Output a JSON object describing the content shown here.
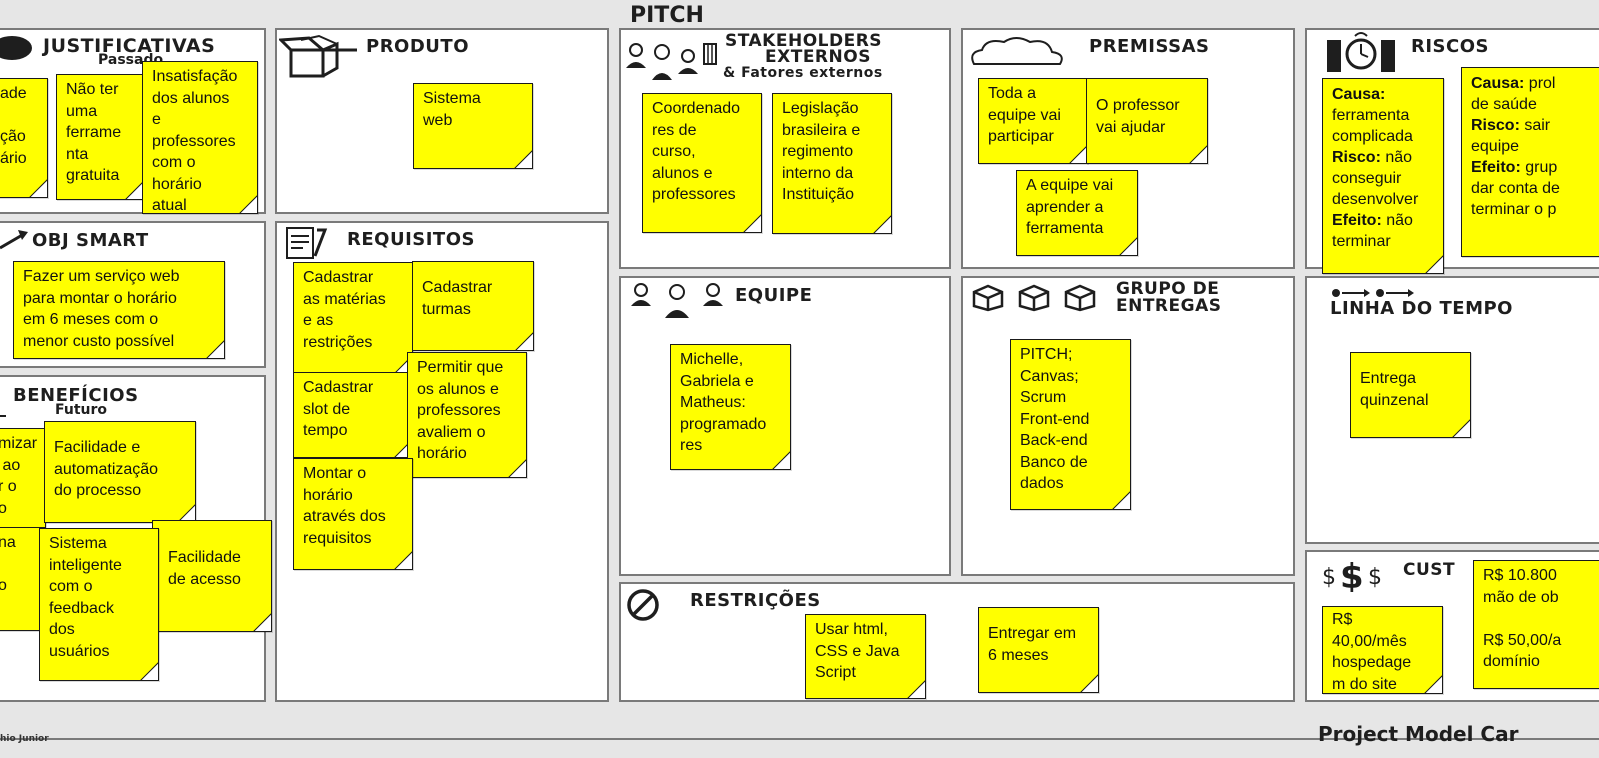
{
  "page_title": "PITCH",
  "footer": {
    "right": "Project Model Car",
    "left": "hio Junior"
  },
  "colors": {
    "note": "#ffff00",
    "panel_border": "#7a7a7a",
    "background": "#e6e6e6",
    "text": "#1e1e1e"
  },
  "sections": {
    "justificativas": {
      "title": "JUSTIFICATIVAS",
      "subtitle": "Passado",
      "icon": "target-icon"
    },
    "produto": {
      "title": "PRODUTO",
      "icon": "open-box-icon"
    },
    "stakeholders": {
      "title_line1": "STAKEHOLDERS",
      "title_line2": "EXTERNOS",
      "title_line3": "& Fatores externos",
      "icon": "people-building-icon"
    },
    "premissas": {
      "title": "PREMISSAS",
      "icon": "cloud-icon"
    },
    "riscos": {
      "title": "RISCOS",
      "icon": "time-bomb-icon"
    },
    "obj_smart": {
      "title": "OBJ SMART",
      "icon": "dart-icon"
    },
    "requisitos": {
      "title": "REQUISITOS",
      "icon": "checklist-icon"
    },
    "equipe": {
      "title": "EQUIPE",
      "icon": "team-icon"
    },
    "grupo_entregas": {
      "title_line1": "GRUPO DE",
      "title_line2": "ENTREGAS",
      "icon": "packages-icon"
    },
    "linha_tempo": {
      "title": "LINHA DO TEMPO",
      "icon": "timeline-icon"
    },
    "beneficios": {
      "title": "BENEFÍCIOS",
      "subtitle": "Futuro",
      "icon": "benefit-icon"
    },
    "restricoes": {
      "title": "RESTRIÇÕES",
      "icon": "prohibited-icon"
    },
    "custos": {
      "title": "CUST",
      "icon": "dollar-icon"
    }
  },
  "notes": {
    "just_1": "ade\n\nção\nário",
    "just_2": "Não ter\numa\nferrame\nnta\ngratuita",
    "just_3": "Insatisfação\ndos alunos\ne\nprofessores\ncom o\nhorário\natual",
    "produto_1": "Sistema\nweb",
    "stake_1": "Coordenado\nres de\ncurso,\nalunos e\nprofessores",
    "stake_2": "Legislação\nbrasileira e\nregimento\ninterno da\nInstituição",
    "prem_1": "Toda a\nequipe vai\nparticipar",
    "prem_2": "O professor\nvai ajudar",
    "prem_3": "A equipe vai\naprender a\nferramenta",
    "risk_1": {
      "causa_label": "Causa:",
      "causa": "ferramenta\ncomplicada",
      "risco_label": "Risco:",
      "risco": " não\nconseguir\ndesenvolver",
      "efeito_label": "Efeito:",
      "efeito": " não\nterminar"
    },
    "risk_2": {
      "causa_label": "Causa:",
      "causa": " prol\nde saúde",
      "risco_label": "Risco:",
      "risco": " sair\nequipe",
      "efeito_label": "Efeito:",
      "efeito": " grup\ndar conta de\nterminar o p"
    },
    "obj_1": "Fazer um serviço web\npara montar o horário\nem 6 meses com o\nmenor custo possível",
    "req_1": "Cadastrar\nas matérias\ne as\nrestrições",
    "req_2": "Cadastrar\nturmas",
    "req_3": "Permitir que\nos alunos e\nprofessores\navaliem o\nhorário",
    "req_4": "Cadastrar\nslot de\ntempo",
    "req_5": "Montar o\nhorário\natravés dos\nrequisitos",
    "equipe_1": "Michelle,\nGabriela e\nMatheus:\nprogramado\nres",
    "entregas_1": "PITCH;\nCanvas;\nScrum\nFront-end\nBack-end\nBanco de\ndados",
    "tempo_1": "Entrega\nquinzenal",
    "ben_1": "mizar\n ao\nr o\no",
    "ben_2": "Facilidade e\nautomatização\ndo processo",
    "ben_3": "na\n\no",
    "ben_4": "Sistema\ninteligente\ncom o\nfeedback\ndos\nusuários",
    "ben_5": "Facilidade\nde acesso",
    "restr_1": "Usar html,\nCSS e Java\nScript",
    "restr_2": "Entregar em\n6 meses",
    "custo_1": "R$\n40,00/mês\nhospedage\nm do site",
    "custo_2": "R$ 10.800\nmão de ob\n\nR$ 50,00/a\ndomínio"
  }
}
